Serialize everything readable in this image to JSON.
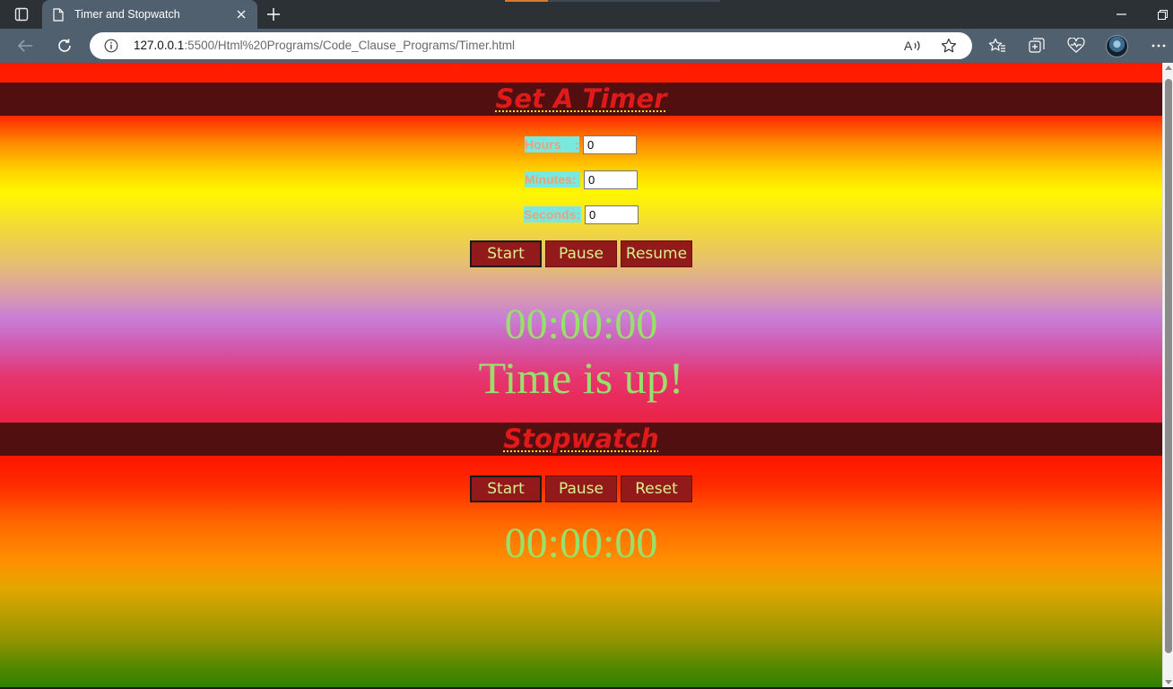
{
  "browser": {
    "tab_title": "Timer and Stopwatch",
    "url_host": "127.0.0.1",
    "url_rest": ":5500/Html%20Programs/Code_Clause_Programs/Timer.html"
  },
  "timer": {
    "heading": "Set A Timer",
    "hours_label": "Hours    :",
    "hours_value": "0",
    "minutes_label": "Minutes:",
    "minutes_value": "0",
    "seconds_label": "Seconds:",
    "seconds_value": "0",
    "start_label": "Start",
    "pause_label": "Pause",
    "resume_label": "Resume",
    "display": "00:00:00",
    "message": "Time is up!"
  },
  "stopwatch": {
    "heading": "Stopwatch",
    "start_label": "Start",
    "pause_label": "Pause",
    "reset_label": "Reset",
    "display": "00:00:00"
  }
}
